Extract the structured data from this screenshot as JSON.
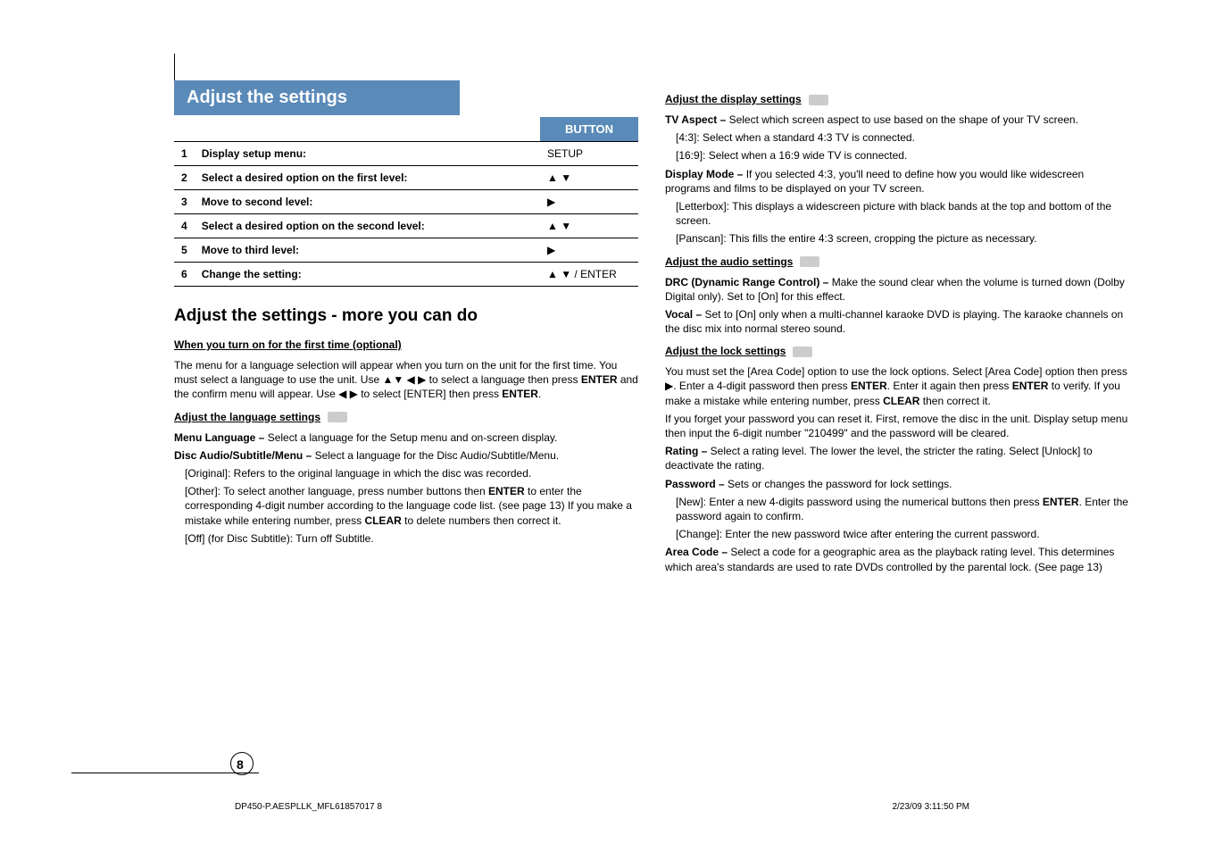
{
  "heading_band": "Adjust the settings",
  "table": {
    "button_header": "BUTTON",
    "rows": [
      {
        "n": "1",
        "step": "Display setup menu:",
        "btn": "SETUP"
      },
      {
        "n": "2",
        "step": "Select a desired option on the first level:",
        "btn": "▲ ▼"
      },
      {
        "n": "3",
        "step": "Move to second level:",
        "btn": "▶"
      },
      {
        "n": "4",
        "step": "Select a desired option on the second level:",
        "btn": "▲ ▼"
      },
      {
        "n": "5",
        "step": "Move to third level:",
        "btn": "▶"
      },
      {
        "n": "6",
        "step": "Change the setting:",
        "btn": "▲ ▼ / ENTER"
      }
    ]
  },
  "more_title": "Adjust the settings - more you can do",
  "first_time_heading": "When you turn on for the first time (optional)",
  "first_time_para_a": "The menu for a language selection will appear when you turn on the unit for the first time. You must select a language to use the unit. Use ▲▼ ◀ ▶ to select a language then press ",
  "bold_enter": "ENTER",
  "first_time_para_b": " and the confirm menu will appear. Use ◀ ▶ to select [ENTER] then press ",
  "first_time_para_c": ".",
  "lang_heading": "Adjust the language settings",
  "menu_language_label": "Menu Language – ",
  "menu_language_text": "Select a language for the Setup menu and on-screen display.",
  "disc_audio_label": "Disc Audio/Subtitle/Menu – ",
  "disc_audio_text": "Select a language for the Disc Audio/Subtitle/Menu.",
  "original_text": "[Original]: Refers to the original language in which the disc was recorded.",
  "other_text_a": "[Other]: To select another language, press number buttons then ",
  "other_text_b": " to enter the corresponding 4-digit number according to the language code list. (see page 13) If you make a mistake while entering number, press ",
  "bold_clear": "CLEAR",
  "other_text_c": " to delete numbers then correct it.",
  "off_text": "[Off] (for Disc Subtitle): Turn off Subtitle.",
  "display_heading": "Adjust the display settings",
  "tv_aspect_label": "TV Aspect – ",
  "tv_aspect_text": "Select which screen aspect to use based on the shape of your TV screen.",
  "aspect_43": "[4:3]: Select when a standard 4:3 TV is connected.",
  "aspect_169": "[16:9]: Select when a 16:9 wide TV is connected.",
  "display_mode_label": "Display Mode – ",
  "display_mode_text": "If you selected 4:3, you'll need to define how you would like widescreen programs and films to be displayed on your TV screen.",
  "letterbox_text": "[Letterbox]: This displays a widescreen picture with black bands at the top and bottom of the screen.",
  "panscan_text": "[Panscan]: This fills the entire 4:3 screen, cropping the picture as necessary.",
  "audio_heading": "Adjust the audio settings",
  "drc_label": "DRC (Dynamic Range Control) – ",
  "drc_text": "Make the sound clear when the volume is turned down (Dolby Digital only). Set to [On] for this effect.",
  "vocal_label": "Vocal – ",
  "vocal_text": "Set to [On] only when a multi-channel karaoke DVD is playing. The karaoke channels on the disc mix into normal stereo sound.",
  "lock_heading": "Adjust the lock settings",
  "lock_para_a": "You must set the [Area Code] option to use the lock options. Select [Area Code] option then press ▶. Enter a 4-digit password then press ",
  "lock_para_b": ". Enter it again then press ",
  "lock_para_c": " to verify. If you make a mistake while entering number, press ",
  "lock_para_d": " then correct it.",
  "forgot_text": "If you forget your password you can reset it. First, remove the disc in the unit. Display setup menu then input the 6-digit number \"210499\" and the password will be cleared.",
  "rating_label": "Rating – ",
  "rating_text": "Select a rating level. The lower the level, the stricter the rating. Select [Unlock] to deactivate the rating.",
  "password_label": "Password – ",
  "password_text": "Sets or changes the password for lock settings.",
  "new_text_a": "[New]: Enter a new 4-digits password using the numerical buttons then press ",
  "new_text_b": ". Enter the password again to confirm.",
  "change_text": "[Change]: Enter the new password twice after entering the current password.",
  "area_code_label": "Area Code – ",
  "area_code_text": "Select a code for a geographic area as the playback rating level. This determines which area's standards are used to rate DVDs controlled by the parental lock. (See page 13)",
  "page_number": "8",
  "footer_left": "DP450-P.AESPLLK_MFL61857017   8",
  "footer_right": "2/23/09   3:11:50 PM"
}
